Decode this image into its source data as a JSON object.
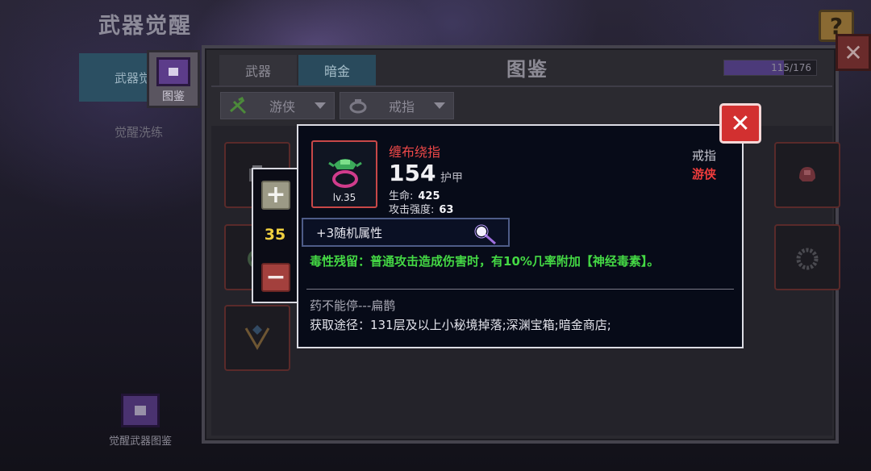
{
  "screen": {
    "title": "武器觉醒",
    "help_label": "?"
  },
  "left_nav": {
    "items": [
      {
        "label": "武器觉醒",
        "active": true
      },
      {
        "label": "觉醒洗练",
        "active": false
      }
    ],
    "codex_button_label": "图鉴",
    "bottom_codex_label": "觉醒武器图鉴"
  },
  "codex": {
    "title": "图鉴",
    "close_label": "✕",
    "tabs": [
      {
        "label": "武器",
        "active": false
      },
      {
        "label": "暗金",
        "active": true
      }
    ],
    "progress": {
      "text": "115/176",
      "fraction": 0.653
    },
    "filters": [
      {
        "label": "游侠",
        "icon": "ranger-icon"
      },
      {
        "label": "戒指",
        "icon": "ring-icon"
      }
    ]
  },
  "stepper": {
    "plus_label": "+",
    "value": "35",
    "minus_label": "−"
  },
  "item": {
    "name": "缠布绕指",
    "level": "lv.35",
    "power": "154",
    "power_label": "护甲",
    "stats": [
      {
        "label": "生命:",
        "value": "425"
      },
      {
        "label": "攻击强度:",
        "value": "63"
      }
    ],
    "type": "戒指",
    "class": "游侠",
    "random_attr": "+3随机属性",
    "effect": "毒性残留：普通攻击造成伤害时，有10%几率附加【神经毒素】。",
    "flavor": "药不能停---扁鹊",
    "source": "获取途径：131层及以上小秘境掉落;深渊宝箱;暗金商店;",
    "close_label": "✕",
    "colors": {
      "name": "#ee4848",
      "class": "#ee3c3c",
      "effect": "#44d844"
    }
  }
}
